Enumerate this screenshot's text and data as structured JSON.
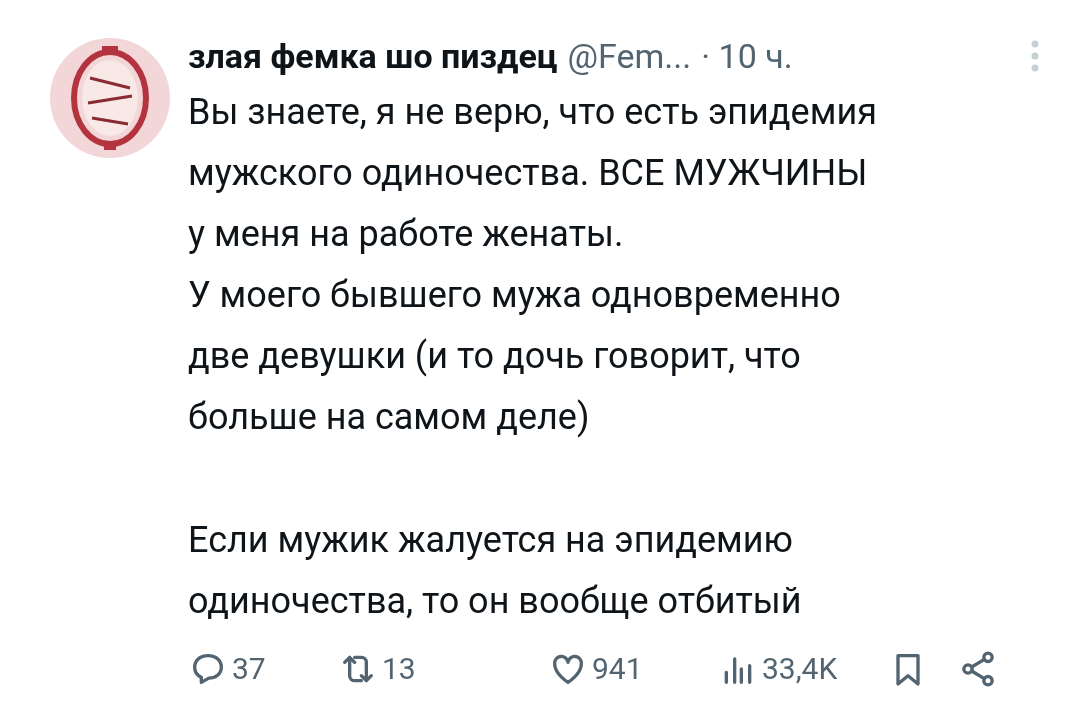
{
  "author": {
    "name": "злая фемка шо пиздец",
    "handle": "@Fem...",
    "time": "· 10 ч."
  },
  "body": [
    [
      "Вы знаете, я не верю, что есть эпидемия",
      "мужского одиночества. ВСЕ МУЖЧИНЫ",
      "у меня на работе женаты.",
      "У моего бывшего мужа одновременно",
      "две девушки (и то дочь говорит, что",
      "больше на самом деле)"
    ],
    [
      "Если мужик жалуется на эпидемию",
      "одиночества, то он вообще отбитый"
    ]
  ],
  "actions": [
    {
      "kind": "reply",
      "count": "37"
    },
    {
      "kind": "repost",
      "count": "13"
    },
    {
      "kind": "like",
      "count": "941"
    },
    {
      "kind": "views",
      "count": "33,4K"
    },
    {
      "kind": "bookmark"
    },
    {
      "kind": "share"
    }
  ]
}
